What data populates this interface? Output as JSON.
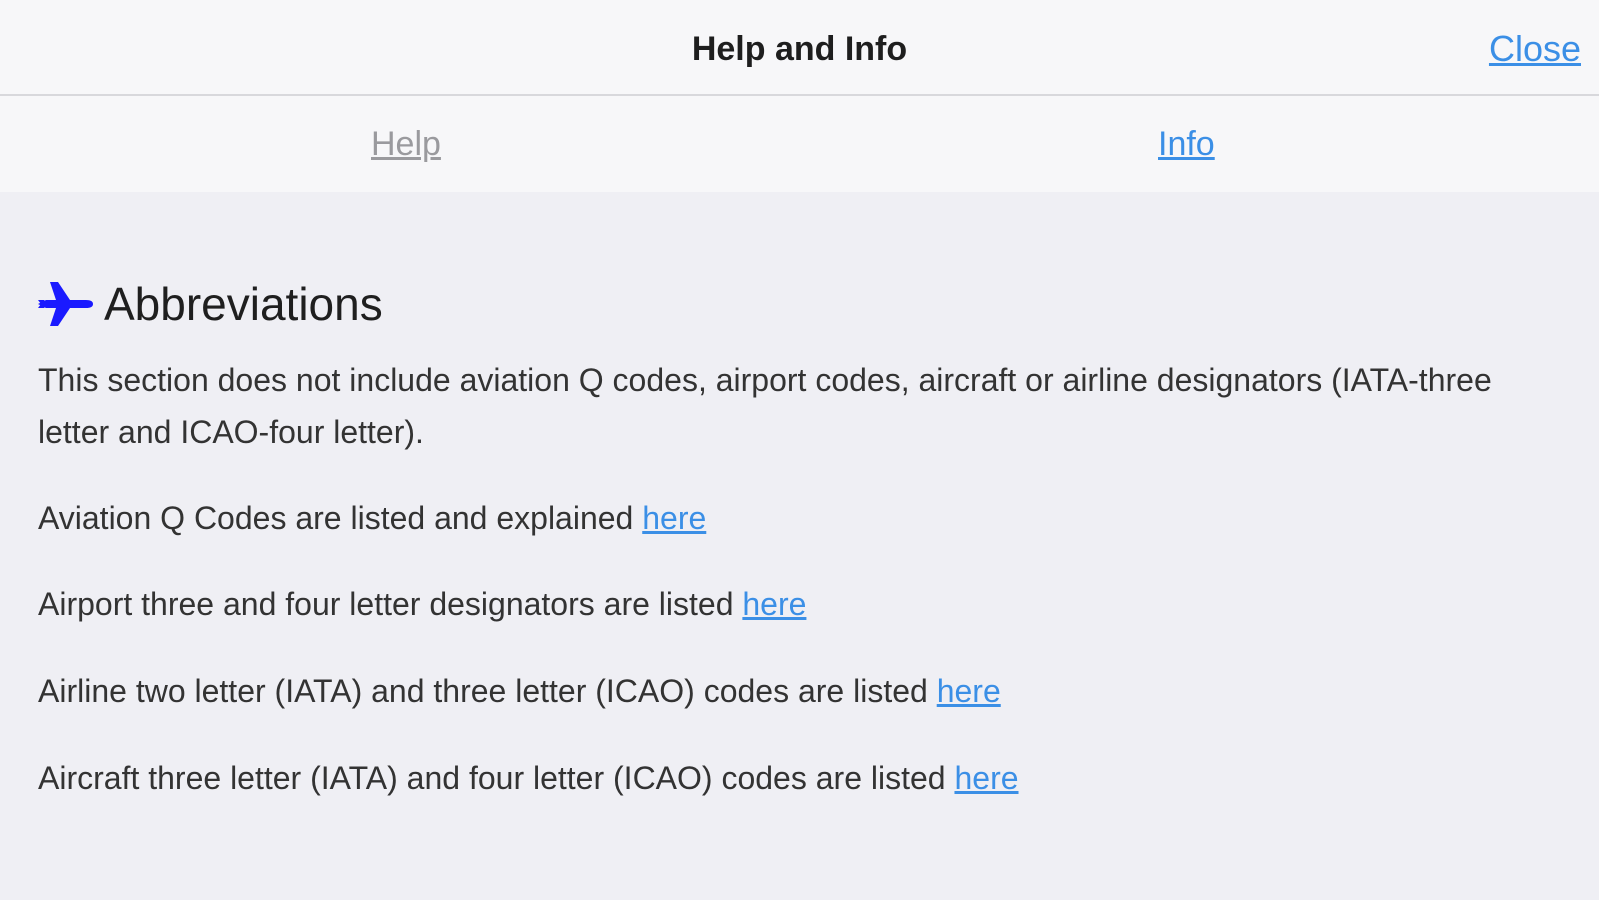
{
  "navbar": {
    "title": "Help and Info",
    "close_label": "Close"
  },
  "tabs": {
    "help_label": "Help",
    "info_label": "Info",
    "selected": "Info"
  },
  "section": {
    "icon": "airplane-icon",
    "title": "Abbreviations",
    "intro": "This section does not include aviation Q codes, airport codes, aircraft or airline designators (IATA-three letter and ICAO-four letter).",
    "items": [
      {
        "text": "Aviation Q Codes are listed and explained ",
        "link_label": "here"
      },
      {
        "text": "Airport three and four letter designators are listed ",
        "link_label": "here"
      },
      {
        "text": "Airline two letter (IATA) and three letter (ICAO) codes are listed ",
        "link_label": "here"
      },
      {
        "text": "Aircraft three letter (IATA) and four letter (ICAO) codes are listed ",
        "link_label": "here"
      }
    ]
  },
  "colors": {
    "accent": "#3b8fe6",
    "icon": "#1a1aff",
    "background": "#efeff4",
    "bar": "#f7f7f9",
    "inactive_tab": "#9a9a9e"
  }
}
